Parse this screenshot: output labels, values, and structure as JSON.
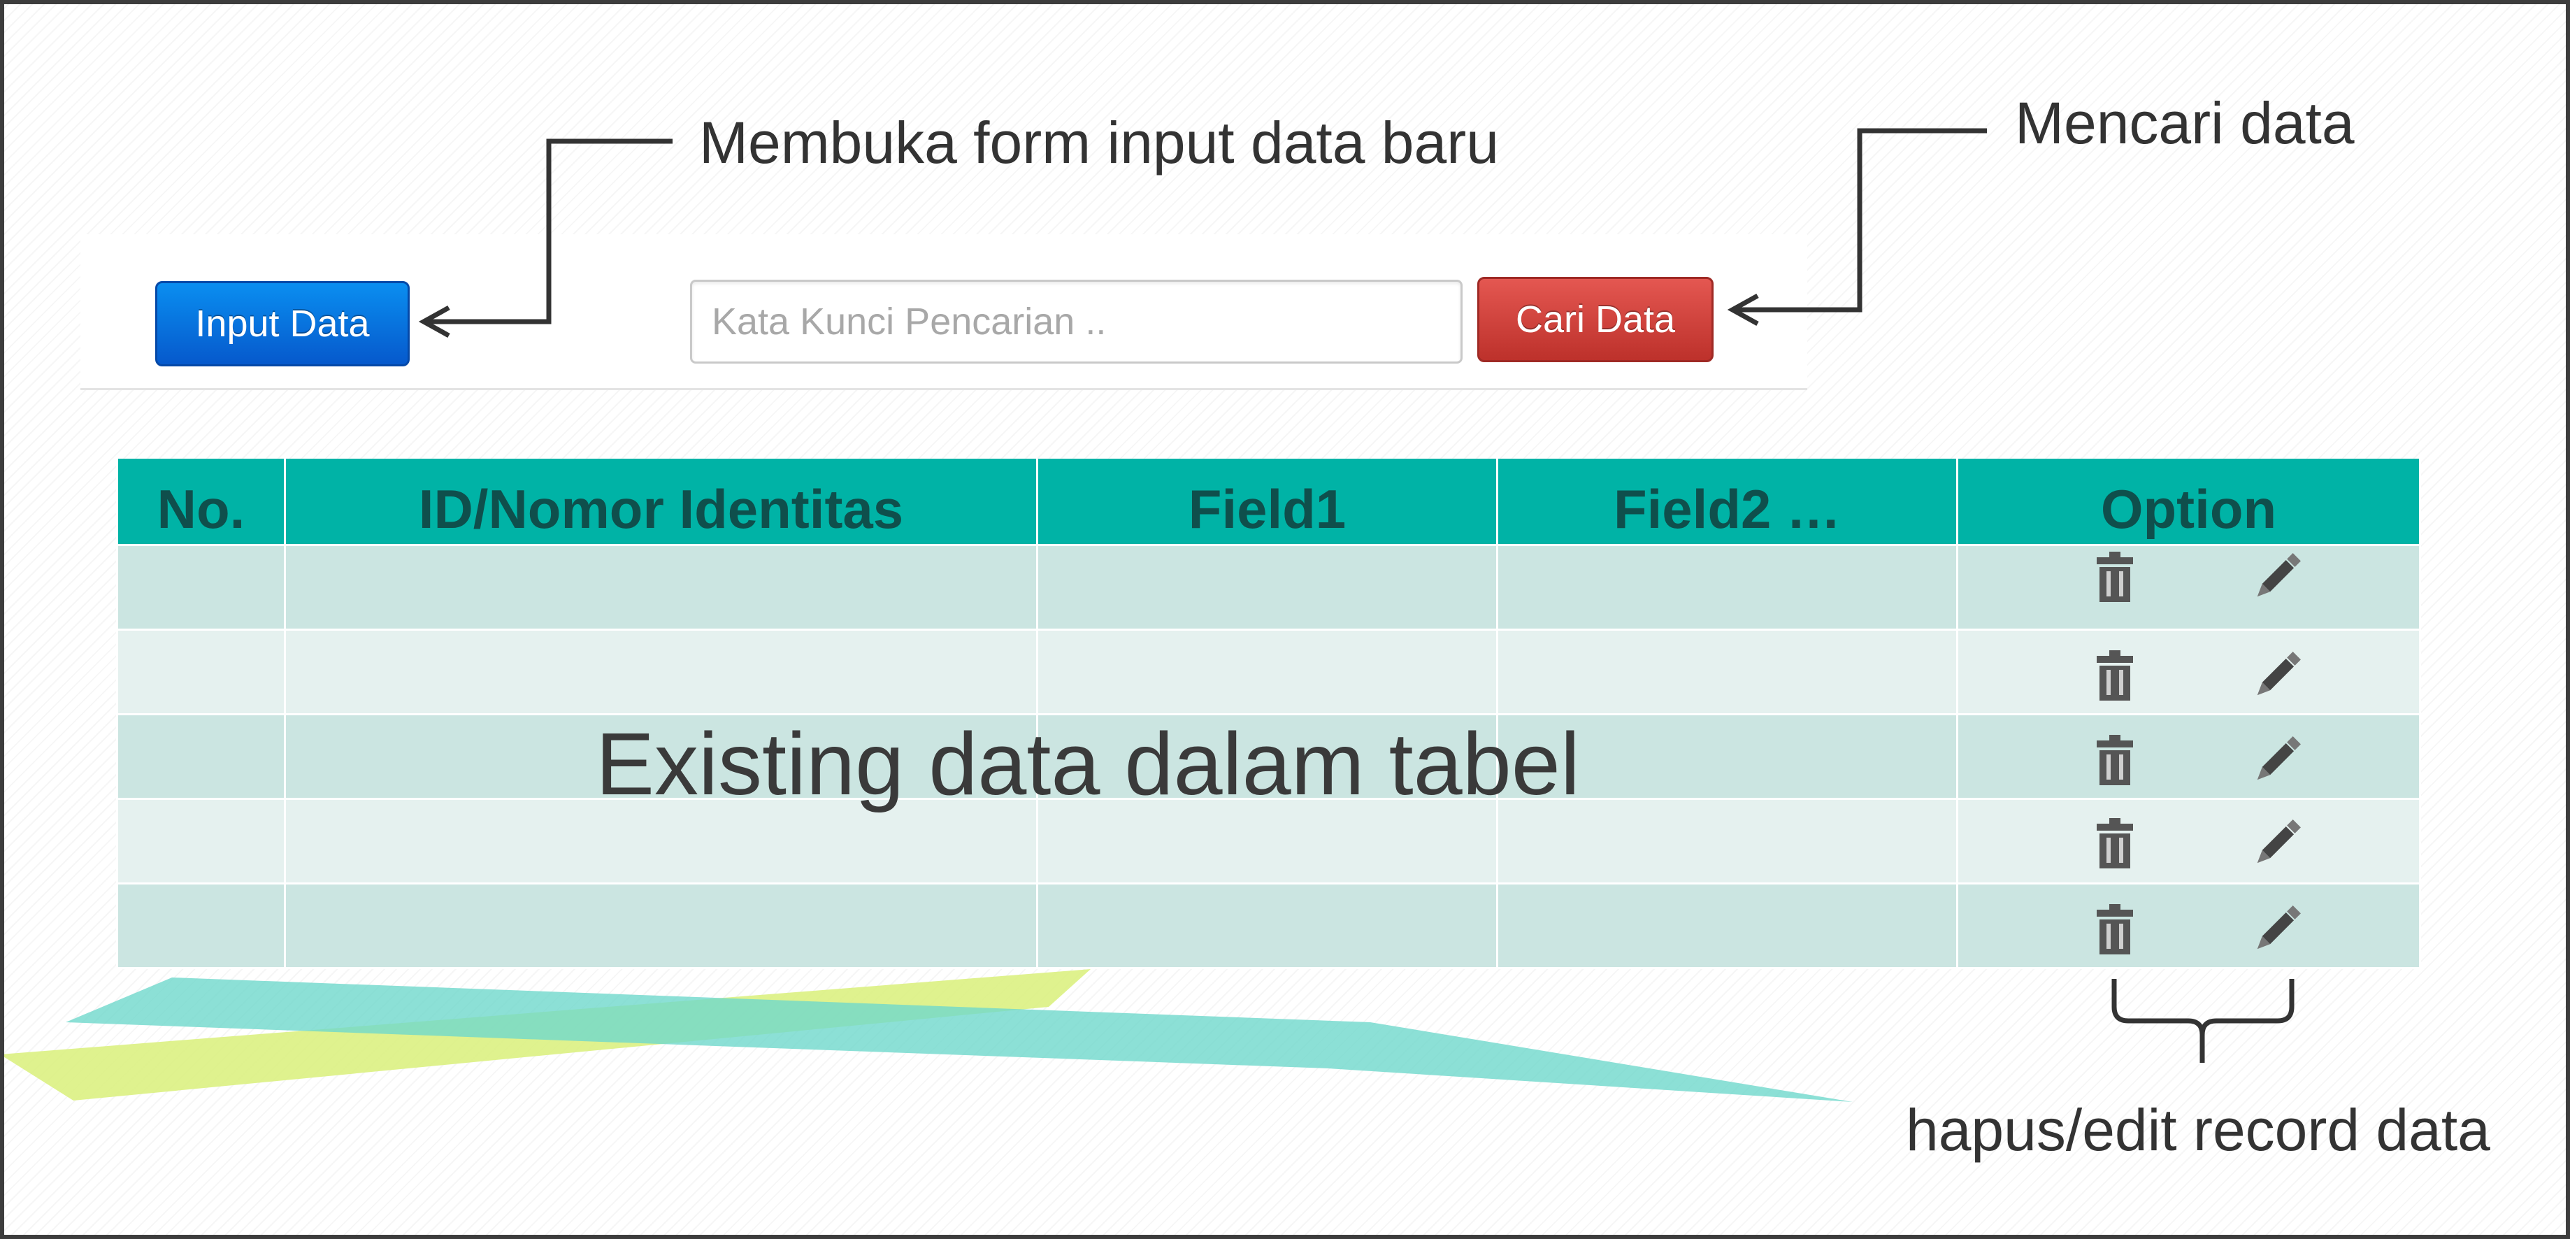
{
  "annotations": {
    "input_caption": "Membuka form input data baru",
    "search_caption": "Mencari data",
    "table_caption": "Existing data dalam tabel",
    "options_caption": "hapus/edit record data"
  },
  "toolbar": {
    "input_button_label": "Input Data",
    "search_placeholder": "Kata Kunci Pencarian ..",
    "search_button_label": "Cari Data"
  },
  "table": {
    "columns": [
      "No.",
      "ID/Nomor Identitas",
      "Field1",
      "Field2 …",
      "Option"
    ],
    "rows": [
      {
        "actions": [
          "trash-icon",
          "pencil-icon"
        ]
      },
      {
        "actions": [
          "trash-icon",
          "pencil-icon"
        ]
      },
      {
        "actions": [
          "trash-icon",
          "pencil-icon"
        ]
      },
      {
        "actions": [
          "trash-icon",
          "pencil-icon"
        ]
      },
      {
        "actions": [
          "trash-icon",
          "pencil-icon"
        ]
      }
    ]
  },
  "colors": {
    "header_bg": "#00b3a6",
    "header_text": "#0f4f4c",
    "row_odd": "#cbe5e1",
    "row_even": "#e5f1ef",
    "input_button": "#0659cc",
    "search_button": "#bd312b"
  }
}
